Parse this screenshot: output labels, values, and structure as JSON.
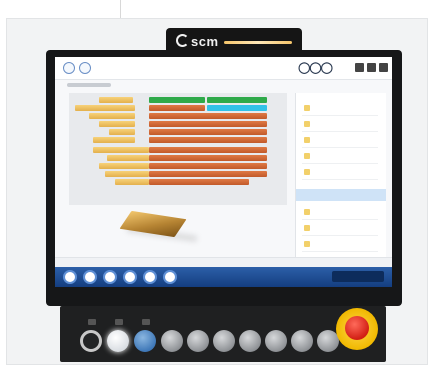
{
  "brand": {
    "logo_text": "scm",
    "label": ""
  },
  "colors": {
    "screen_bg": "#f7f8fa",
    "toolbar": "#1f4f96",
    "pine_wood": "#f2c66d",
    "red_wood": "#c85f2c",
    "highlight_green": "#2faa4a",
    "highlight_cyan": "#31c2e8",
    "emergency_stop": "#d21f14"
  },
  "app_icons": [
    "home-icon",
    "settings-icon"
  ],
  "toolbar_icons": [
    "machine-icon",
    "layout-icon",
    "print-icon",
    "info-icon",
    "edit-icon",
    "search-icon"
  ],
  "control_buttons": [
    "power-button",
    "white-button",
    "blue-button",
    "grey-button",
    "grey-button",
    "grey-button",
    "grey-button",
    "grey-button",
    "grey-button",
    "grey-button"
  ]
}
